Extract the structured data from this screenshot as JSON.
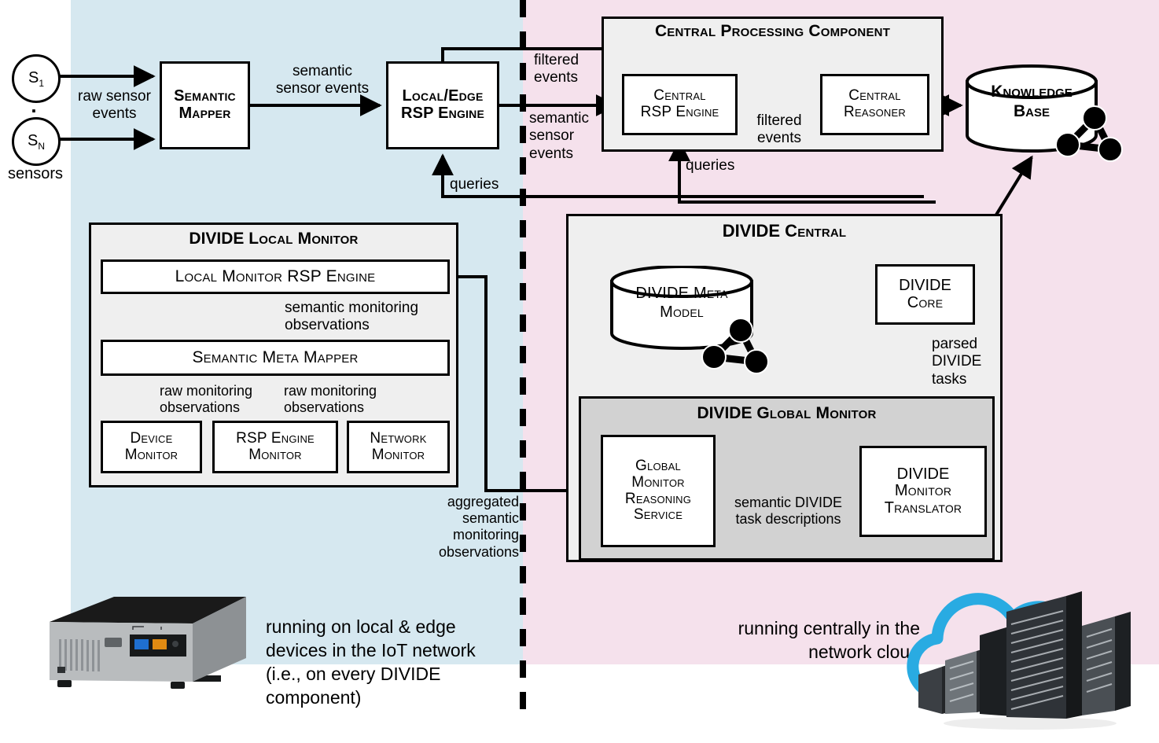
{
  "regions": {
    "local": {
      "name": "local-edge-region",
      "color": "#d6e8f0"
    },
    "central": {
      "name": "central-cloud-region",
      "color": "#f5e1ec"
    }
  },
  "sensors": {
    "first": "S",
    "first_sub": "1",
    "last": "S",
    "last_sub": "N",
    "group_label": "sensors",
    "vertical_dots": "⋮"
  },
  "nodes": {
    "semantic_mapper": {
      "line1": "Semantic",
      "line2": "Mapper"
    },
    "local_edge_rsp": {
      "line1": "Local/Edge",
      "line2": "RSP Engine"
    },
    "central_rsp": {
      "line1": "Central",
      "line2": "RSP Engine"
    },
    "central_reasoner": {
      "line1": "Central",
      "line2": "Reasoner"
    },
    "knowledge_base": {
      "line1": "Knowledge",
      "line2": "Base"
    },
    "local_monitor_rsp": {
      "line1": "Local Monitor RSP Engine"
    },
    "semantic_meta_mapper": {
      "line1": "Semantic Meta Mapper"
    },
    "device_monitor": {
      "line1": "Device",
      "line2": "Monitor"
    },
    "rsp_engine_monitor": {
      "line1": "RSP Engine",
      "line2": "Monitor"
    },
    "network_monitor": {
      "line1": "Network",
      "line2": "Monitor"
    },
    "divide_meta_model": {
      "line1": "DIVIDE Meta",
      "line2": "Model"
    },
    "divide_core": {
      "line1": "DIVIDE",
      "line2": "Core"
    },
    "global_monitor_reasoning": {
      "line1": "Global",
      "line2": "Monitor",
      "line3": "Reasoning",
      "line4": "Service"
    },
    "divide_monitor_translator": {
      "line1": "DIVIDE",
      "line2": "Monitor",
      "line3": "Translator"
    }
  },
  "groups": {
    "central_processing_component": "Central Processing Component",
    "divide_local_monitor": "DIVIDE Local Monitor",
    "divide_central": "DIVIDE Central",
    "divide_global_monitor": "DIVIDE Global Monitor"
  },
  "edge_labels": {
    "raw_sensor_events": "raw sensor\nevents",
    "semantic_sensor_events_local": "semantic\nsensor events",
    "filtered_events_in": "filtered\nevents",
    "semantic_sensor_events_central": "semantic\nsensor\nevents",
    "filtered_events_mid": "filtered\nevents",
    "queries_local": "queries",
    "queries_central": "queries",
    "semantic_monitoring_observations": "semantic monitoring\nobservations",
    "raw_monitoring_observations_left": "raw monitoring\nobservations",
    "raw_monitoring_observations_right": "raw monitoring\nobservations",
    "aggregated_semantic_monitoring_observations": "aggregated\nsemantic\nmonitoring\nobservations",
    "semantic_divide_task_descriptions": "semantic DIVIDE\ntask descriptions",
    "parsed_divide_tasks": "parsed\nDIVIDE\ntasks"
  },
  "captions": {
    "local": "running on local & edge devices in the IoT network (i.e., on every DIVIDE component)",
    "central": "running centrally in the network cloud"
  },
  "colors": {
    "local_bg": "#d6e8f0",
    "central_bg": "#f5e1ec",
    "group_bg": "#efefef",
    "group_dark_bg": "#d2d2d2",
    "stroke": "#000000",
    "cloud_blue": "#29abe2"
  }
}
